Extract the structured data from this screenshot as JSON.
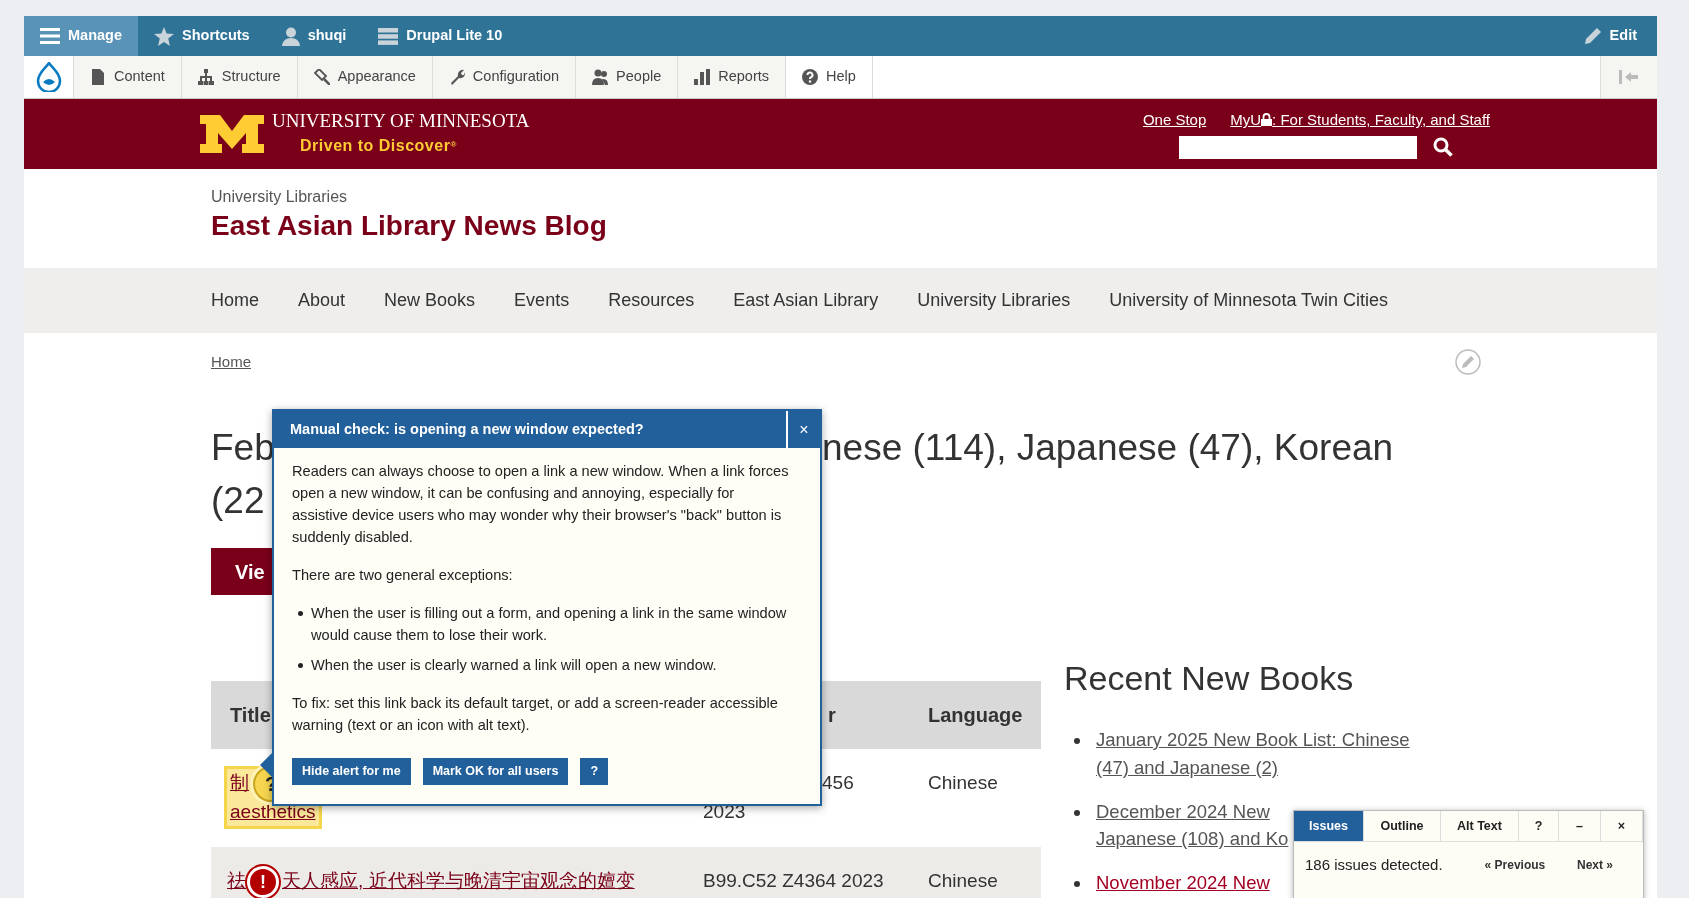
{
  "admin_bar": {
    "items": [
      {
        "label": "Manage",
        "selected": true
      },
      {
        "label": "Shortcuts",
        "selected": false
      },
      {
        "label": "shuqi",
        "selected": false
      },
      {
        "label": "Drupal Lite 10",
        "selected": false
      }
    ],
    "edit": "Edit"
  },
  "toolbar": {
    "items": [
      {
        "label": "Content",
        "selected": false
      },
      {
        "label": "Structure",
        "selected": false
      },
      {
        "label": "Appearance",
        "selected": false
      },
      {
        "label": "Configuration",
        "selected": false
      },
      {
        "label": "People",
        "selected": false
      },
      {
        "label": "Reports",
        "selected": false
      },
      {
        "label": "Help",
        "selected": true
      }
    ]
  },
  "brand_header": {
    "wordmark": "UNIVERSITY OF MINNESOTA",
    "tagline": "Driven to Discover$^{®}$",
    "links": [
      "One Stop"
    ],
    "myu": "MyU",
    "myu_rest": ": For Students, Faculty, and Staff"
  },
  "site": {
    "parent": "University Libraries",
    "title": "East Asian Library News Blog"
  },
  "nav": [
    "Home",
    "About",
    "New Books",
    "Events",
    "Resources",
    "East Asian Library",
    "University Libraries",
    "University of Minnesota Twin Cities"
  ],
  "breadcrumb": [
    "Home"
  ],
  "heading": {
    "line1_start": "Feb",
    "line1_end": "nese (114), Japanese (47), Korean",
    "line2": "(22"
  },
  "view_button": "Vie",
  "table": {
    "columns": [
      "Title",
      "r",
      "Language"
    ],
    "rows": [
      {
        "title": [
          "制",
          "aesthetics"
        ],
        "call_number": [
          "456",
          "2023"
        ],
        "language": "Chinese",
        "issue": {
          "kind": "manual",
          "mark": "?"
        }
      },
      {
        "title": [
          "祛",
          "天人感应, 近代科学与晚清宇宙观念的嬗变"
        ],
        "call_number": [
          "B99.C52 Z4364 2023"
        ],
        "language": "Chinese",
        "issue": {
          "kind": "error",
          "mark": "!"
        }
      }
    ]
  },
  "dialog": {
    "title": "Manual check: is opening a new window expected?",
    "close": "×",
    "intro": "Readers can always choose to open a link a new window. When a link forces open a new window, it can be confusing and annoying, especially for assistive device users who may wonder why their browser's \"back\" button is suddenly disabled.",
    "exceptions_intro": "There are two general exceptions:",
    "bullets": [
      "When the user is filling out a form, and opening a link in the same window would cause them to lose their work.",
      "When the user is clearly warned a link will open a new window."
    ],
    "fix": "To fix: set this link back its default target, or add a screen-reader accessible warning (text or an icon with alt text).",
    "buttons": [
      "Hide alert for me",
      "Mark OK for all users",
      "?"
    ]
  },
  "sidebar": {
    "title": "Recent New Books",
    "items": [
      {
        "lines": [
          "January 2025 New Book List: Chinese (47) and Japanese (2)"
        ],
        "active": false
      },
      {
        "lines": [
          "December 2024 New",
          "Japanese (108) and Ko"
        ],
        "active": false
      },
      {
        "lines": [
          "November 2024 New"
        ],
        "active": true
      }
    ]
  },
  "checker": {
    "tabs": [
      {
        "label": "Issues",
        "selected": true
      },
      {
        "label": "Outline",
        "selected": false
      },
      {
        "label": "Alt Text",
        "selected": false
      },
      {
        "label": "?",
        "selected": false
      },
      {
        "label": "–",
        "selected": false
      },
      {
        "label": "×",
        "selected": false
      }
    ],
    "message": "186 issues detected.",
    "previous": "« Previous",
    "next": "Next »"
  }
}
